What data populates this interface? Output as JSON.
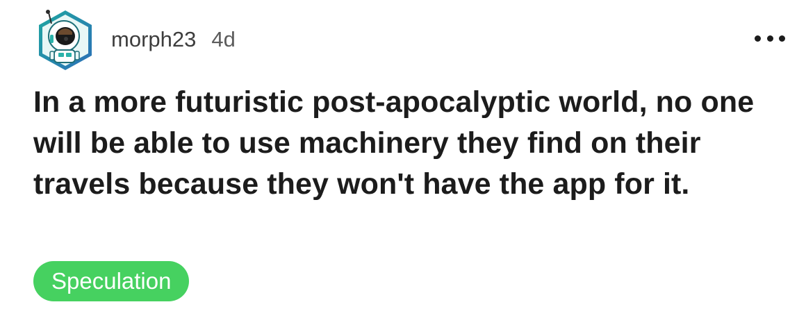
{
  "post": {
    "author": "morph23",
    "age": "4d",
    "title": "In a more futuristic post-apocalyptic world, no one will be able to use machinery they find on their travels because they won't have the app for it.",
    "flair": "Speculation",
    "more_icon": "more-options-icon",
    "avatar_icon": "robot-avatar-icon"
  },
  "colors": {
    "flair_bg": "#46d160",
    "text": "#1c1c1c",
    "meta_text": "#4a4a4a"
  }
}
